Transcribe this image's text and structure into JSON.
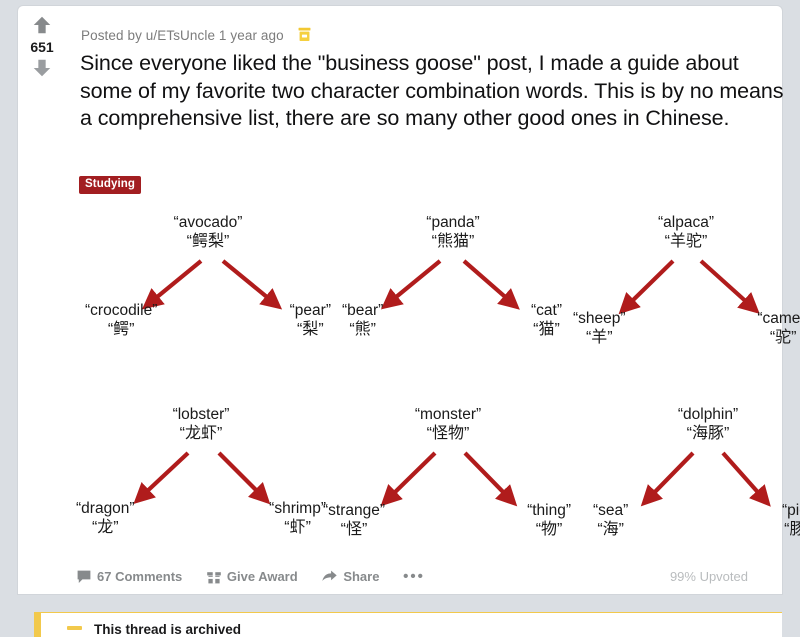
{
  "post": {
    "score": "651",
    "upvote_icon": "arrow-up-icon",
    "downvote_icon": "arrow-down-icon",
    "meta": "Posted by u/ETsUncle 1 year ago",
    "award_icon": "award-icon",
    "title": "Since everyone liked the \"business goose\" post, I made a guide about some of my favorite two character combination words. This is by no means a comprehensive list, there are so many other good ones in Chinese.",
    "flair": "Studying",
    "flair_color": "#a21e21"
  },
  "diagram": {
    "arrow_color": "#b01c1c",
    "trees": [
      {
        "parent_en": "“avocado”",
        "parent_zh": "“鳄梨”",
        "left_en": "“crocodile”",
        "left_zh": "“鳄”",
        "right_en": "“pear”",
        "right_zh": "“梨”"
      },
      {
        "parent_en": "“panda”",
        "parent_zh": "“熊猫”",
        "left_en": "“bear”",
        "left_zh": "“熊”",
        "right_en": "“cat”",
        "right_zh": "“猫”"
      },
      {
        "parent_en": "“alpaca”",
        "parent_zh": "“羊驼”",
        "left_en": "“sheep”",
        "left_zh": "“羊”",
        "right_en": "“camel”",
        "right_zh": "“驼”"
      },
      {
        "parent_en": "“lobster”",
        "parent_zh": "“龙虾”",
        "left_en": "“dragon”",
        "left_zh": "“龙”",
        "right_en": "“shrimp”",
        "right_zh": "“虾”"
      },
      {
        "parent_en": "“monster”",
        "parent_zh": "“怪物”",
        "left_en": "“strange”",
        "left_zh": "“怪”",
        "right_en": "“thing”",
        "right_zh": "“物”"
      },
      {
        "parent_en": "“dolphin”",
        "parent_zh": "“海豚”",
        "left_en": "“sea”",
        "left_zh": "“海”",
        "right_en": "“pig”",
        "right_zh": "“豚”"
      }
    ]
  },
  "actions": {
    "comments": "67 Comments",
    "comments_icon": "comment-bubble-icon",
    "give_award": "Give Award",
    "award_icon": "gift-icon",
    "share": "Share",
    "share_icon": "share-arrow-icon",
    "more": "•••",
    "more_icon": "ellipsis-icon",
    "upvoted": "99% Upvoted"
  },
  "archived": {
    "text": "This thread is archived",
    "accent_color": "#f2c94c"
  }
}
